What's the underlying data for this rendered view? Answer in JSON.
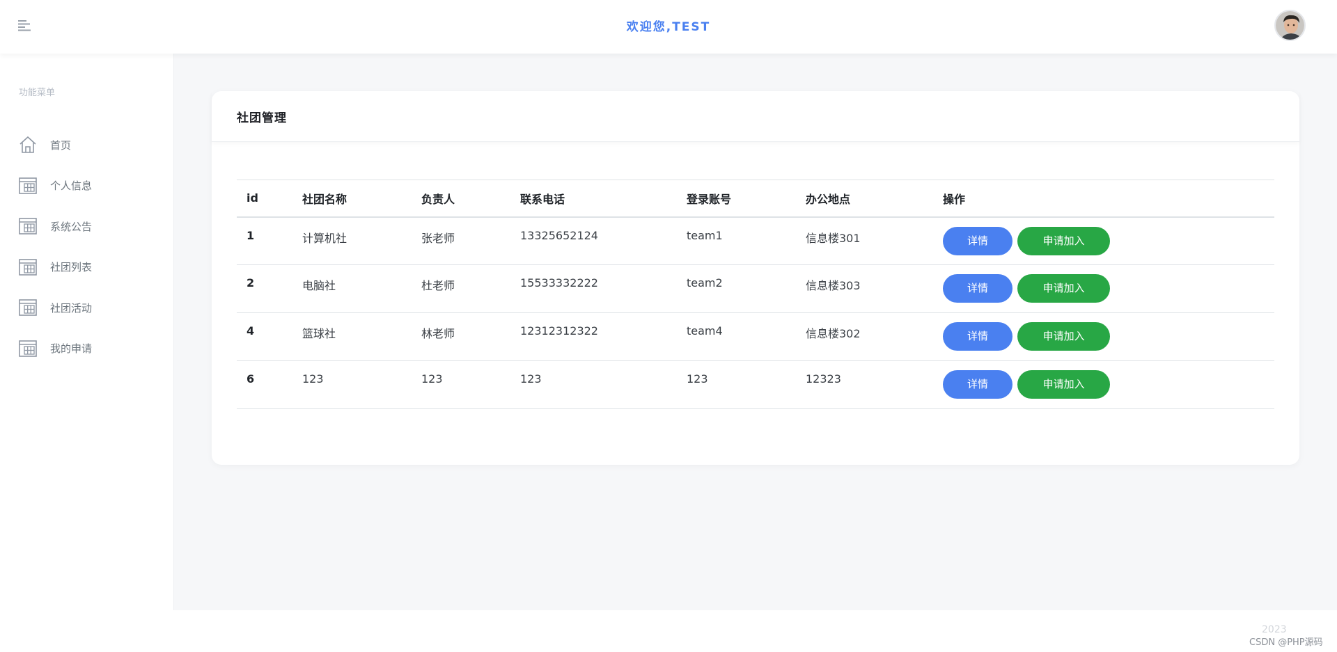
{
  "header": {
    "welcome_prefix": "欢迎您,",
    "welcome_user": "TEST",
    "accent": "#4a80f0"
  },
  "sidebar": {
    "heading": "功能菜单",
    "items": [
      {
        "label": "首页",
        "icon": "home-icon"
      },
      {
        "label": "个人信息",
        "icon": "calendar-icon"
      },
      {
        "label": "系统公告",
        "icon": "calendar-icon"
      },
      {
        "label": "社团列表",
        "icon": "calendar-icon"
      },
      {
        "label": "社团活动",
        "icon": "calendar-icon"
      },
      {
        "label": "我的申请",
        "icon": "calendar-icon"
      }
    ]
  },
  "card": {
    "title": "社团管理"
  },
  "table": {
    "columns": [
      "id",
      "社团名称",
      "负责人",
      "联系电话",
      "登录账号",
      "办公地点",
      "操作"
    ],
    "rows": [
      {
        "id": "1",
        "name": "计算机社",
        "leader": "张老师",
        "phone": "13325652124",
        "account": "team1",
        "office": "信息楼301"
      },
      {
        "id": "2",
        "name": "电脑社",
        "leader": "杜老师",
        "phone": "15533332222",
        "account": "team2",
        "office": "信息楼303"
      },
      {
        "id": "4",
        "name": "篮球社",
        "leader": "林老师",
        "phone": "12312312322",
        "account": "team4",
        "office": "信息楼302"
      },
      {
        "id": "6",
        "name": "123",
        "leader": "123",
        "phone": "123",
        "account": "123",
        "office": "12323"
      }
    ],
    "detail_label": "详情",
    "join_label": "申请加入"
  },
  "footer": {
    "year": "2023",
    "credit": "CSDN @PHP源码"
  },
  "colors": {
    "primary_button": "#4a80f0",
    "success_button": "#28a745",
    "page_background": "#f6f7f9"
  }
}
